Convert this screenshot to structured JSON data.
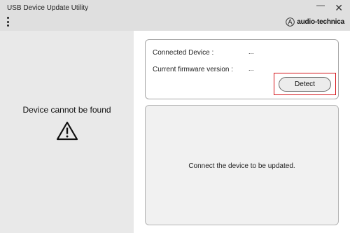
{
  "window": {
    "title": "USB Device Update Utility",
    "minimize_glyph": "—",
    "close_glyph": "✕"
  },
  "header": {
    "menu_icon": "kebab-menu-icon",
    "logo_text": "audio-technica"
  },
  "left_panel": {
    "status_text": "Device cannot be found",
    "status_icon": "warning-icon"
  },
  "device_info": {
    "connected_device_label": "Connected Device :",
    "connected_device_value": "...",
    "firmware_label": "Current firmware version :",
    "firmware_value": "...",
    "detect_button": "Detect"
  },
  "message_panel": {
    "text": "Connect the device to be updated."
  },
  "colors": {
    "titlebar": "#dfdfdf",
    "left_panel": "#e9e9e9",
    "highlight_border": "#d4141a"
  }
}
